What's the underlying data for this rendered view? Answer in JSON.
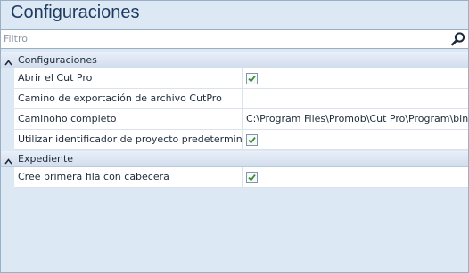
{
  "title": "Configuraciones",
  "filter": {
    "placeholder": "Filtro",
    "value": ""
  },
  "icons": {
    "search": "magnifier-icon",
    "collapse": "collapse-arrow-icon",
    "check": "checkmark-icon"
  },
  "colors": {
    "title": "#1e3b61",
    "background": "#dde8f5",
    "border": "#9aaec6",
    "check": "#3c8a2e"
  },
  "categories": [
    {
      "label": "Configuraciones",
      "rows": [
        {
          "name": "Abrir el Cut Pro",
          "type": "checkbox",
          "checked": true
        },
        {
          "name": "Camino de exportación de archivo CutPro",
          "type": "text",
          "value": ""
        },
        {
          "name": "Caminoho completo",
          "type": "text",
          "value": "C:\\Program Files\\Promob\\Cut Pro\\Program\\bin"
        },
        {
          "name": "Utilizar identificador de proyecto predeterminado",
          "type": "checkbox",
          "checked": true
        }
      ]
    },
    {
      "label": "Expediente",
      "rows": [
        {
          "name": "Cree primera fila con cabecera",
          "type": "checkbox",
          "checked": true
        }
      ]
    }
  ]
}
